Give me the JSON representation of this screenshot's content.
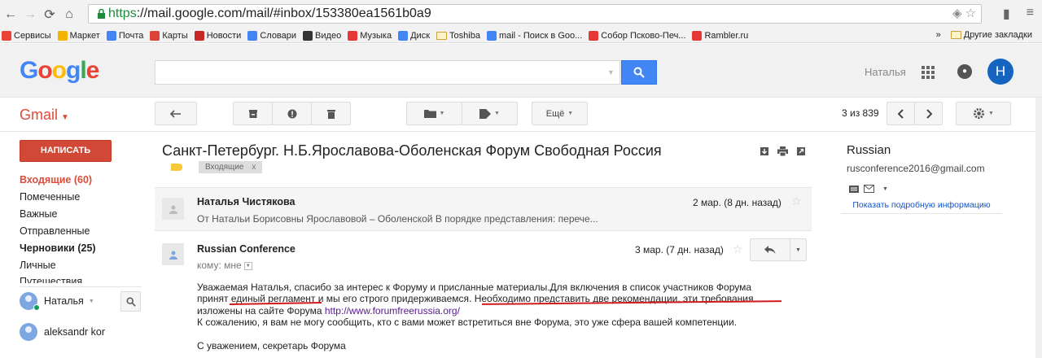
{
  "browser": {
    "url_https": "https",
    "url_rest": "://mail.google.com/mail/#inbox/153380ea1561b0a9"
  },
  "bookmarks": [
    {
      "label": "Сервисы",
      "color": "#ea4335"
    },
    {
      "label": "Маркет",
      "color": "#f4b400"
    },
    {
      "label": "Почта",
      "color": "#4285f4"
    },
    {
      "label": "Карты",
      "color": "#db4437"
    },
    {
      "label": "Новости",
      "color": "#c62828"
    },
    {
      "label": "Словари",
      "color": "#4285f4"
    },
    {
      "label": "Видео",
      "color": "#333333"
    },
    {
      "label": "Музыка",
      "color": "#e53935"
    },
    {
      "label": "Диск",
      "color": "#4285f4"
    },
    {
      "label": "Toshiba",
      "color": "folder"
    },
    {
      "label": "mail - Поиск в Goo...",
      "color": "#4285f4"
    },
    {
      "label": "Собор Псково-Печ...",
      "color": "#e53935"
    },
    {
      "label": "Rambler.ru",
      "color": "#e53935"
    }
  ],
  "bookmarks_more": "»",
  "bookmarks_other": "Другие закладки",
  "google_logo": [
    "G",
    "o",
    "o",
    "g",
    "l",
    "e"
  ],
  "header": {
    "search_value": "",
    "user_name": "Наталья",
    "avatar_letter": "Н"
  },
  "toolbar": {
    "gmail_label": "Gmail",
    "more_label": "Ещё",
    "count": "3 из 839"
  },
  "sidebar": {
    "compose": "НАПИСАТЬ",
    "items": [
      {
        "label": "Входящие (60)",
        "style": "active"
      },
      {
        "label": "Помеченные",
        "style": ""
      },
      {
        "label": "Важные",
        "style": ""
      },
      {
        "label": "Отправленные",
        "style": ""
      },
      {
        "label": "Черновики (25)",
        "style": "bold"
      },
      {
        "label": "Личные",
        "style": ""
      },
      {
        "label": "Путешествия",
        "style": "cut"
      }
    ],
    "hangouts_user": "Наталья",
    "contact": "aleksandr kor"
  },
  "thread": {
    "subject": "Санкт-Петербург. Н.Б.Ярославова-Оболенская Форум Свободная Россия",
    "label_chip": "Входящие",
    "label_chip_x": "x"
  },
  "messages": [
    {
      "sender": "Наталья Чистякова",
      "date": "2 мар. (8 дн. назад)",
      "snippet": "От Натальи Борисовны Ярославовой – Оболенской В порядке представления: перече..."
    },
    {
      "sender": "Russian Conference",
      "date": "3 мар. (7 дн. назад)",
      "to": "кому: мне",
      "body": {
        "line1": "Уважаемая Наталья, спасибо за интерес к Форуму и присланные материалы.Для включения в список участников Форума",
        "line2": "принят единый регламент и мы его строго придерживаемся. Необходимо представить две рекомендации, эти требования",
        "line3_pre": "изложены на сайте Форума ",
        "link": "http://www.forumfreerussia.org/",
        "line4": "К сожалению, я вам не могу сообщить, кто с вами может встретиться вне Форума, это уже сфера вашей компетенции.",
        "line5": "С уважением, секретарь Форума"
      }
    }
  ],
  "right_panel": {
    "name": "Russian",
    "email": "rusconference2016@gmail.com",
    "details_link": "Показать подробную информацию"
  },
  "colors": {
    "accent_red": "#dd4b39",
    "compose_red": "#d14836",
    "search_blue": "#4285f4",
    "annotation_red": "#d11a1a"
  }
}
